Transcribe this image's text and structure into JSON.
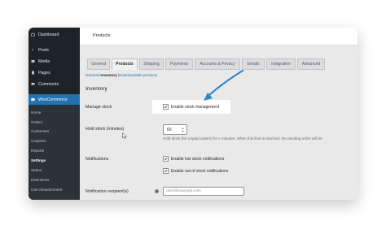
{
  "sidebar": {
    "items": [
      {
        "label": "Dashboard",
        "icon": "dashboard-icon"
      },
      {
        "label": "Posts",
        "icon": "pin-icon"
      },
      {
        "label": "Media",
        "icon": "media-icon"
      },
      {
        "label": "Pages",
        "icon": "pages-icon"
      },
      {
        "label": "Comments",
        "icon": "comment-icon"
      }
    ],
    "woocommerce": {
      "label": "WooCommerce",
      "icon": "woocommerce-icon"
    },
    "submenu": [
      {
        "label": "Home"
      },
      {
        "label": "Orders"
      },
      {
        "label": "Customers"
      },
      {
        "label": "Coupons"
      },
      {
        "label": "Reports"
      },
      {
        "label": "Settings"
      },
      {
        "label": "Status"
      },
      {
        "label": "Extensions"
      },
      {
        "label": "Cart Abandonment"
      }
    ]
  },
  "header": {
    "title": "Products"
  },
  "tabs": [
    {
      "label": "General"
    },
    {
      "label": "Products"
    },
    {
      "label": "Shipping"
    },
    {
      "label": "Payments"
    },
    {
      "label": "Accounts & Privacy"
    },
    {
      "label": "Emails"
    },
    {
      "label": "Integration"
    },
    {
      "label": "Advanced"
    }
  ],
  "subnav": {
    "general": "General",
    "sep1": "|",
    "inventory": "Inventory",
    "sep2": "|",
    "downloadable": "Downloadable products"
  },
  "section_title": "Inventory",
  "manage_stock": {
    "label": "Manage stock",
    "checkbox_label": "Enable stock management",
    "checked": true
  },
  "hold_stock": {
    "label": "Hold stock (minutes)",
    "value": "60",
    "description": "Hold stock (for unpaid orders) for x minutes. When this limit is reached, the pending order will be"
  },
  "notifications": {
    "label": "Notifications",
    "low_stock": {
      "label": "Enable low stock notifications",
      "checked": true
    },
    "out_of_stock": {
      "label": "Enable out of stock notifications",
      "checked": true
    }
  },
  "recipient": {
    "label": "Notification recipient(s)",
    "value": "user@example.com"
  },
  "colors": {
    "sidebar": "#1d2327",
    "accent": "#2271b1",
    "arrow": "#2f86c8"
  }
}
